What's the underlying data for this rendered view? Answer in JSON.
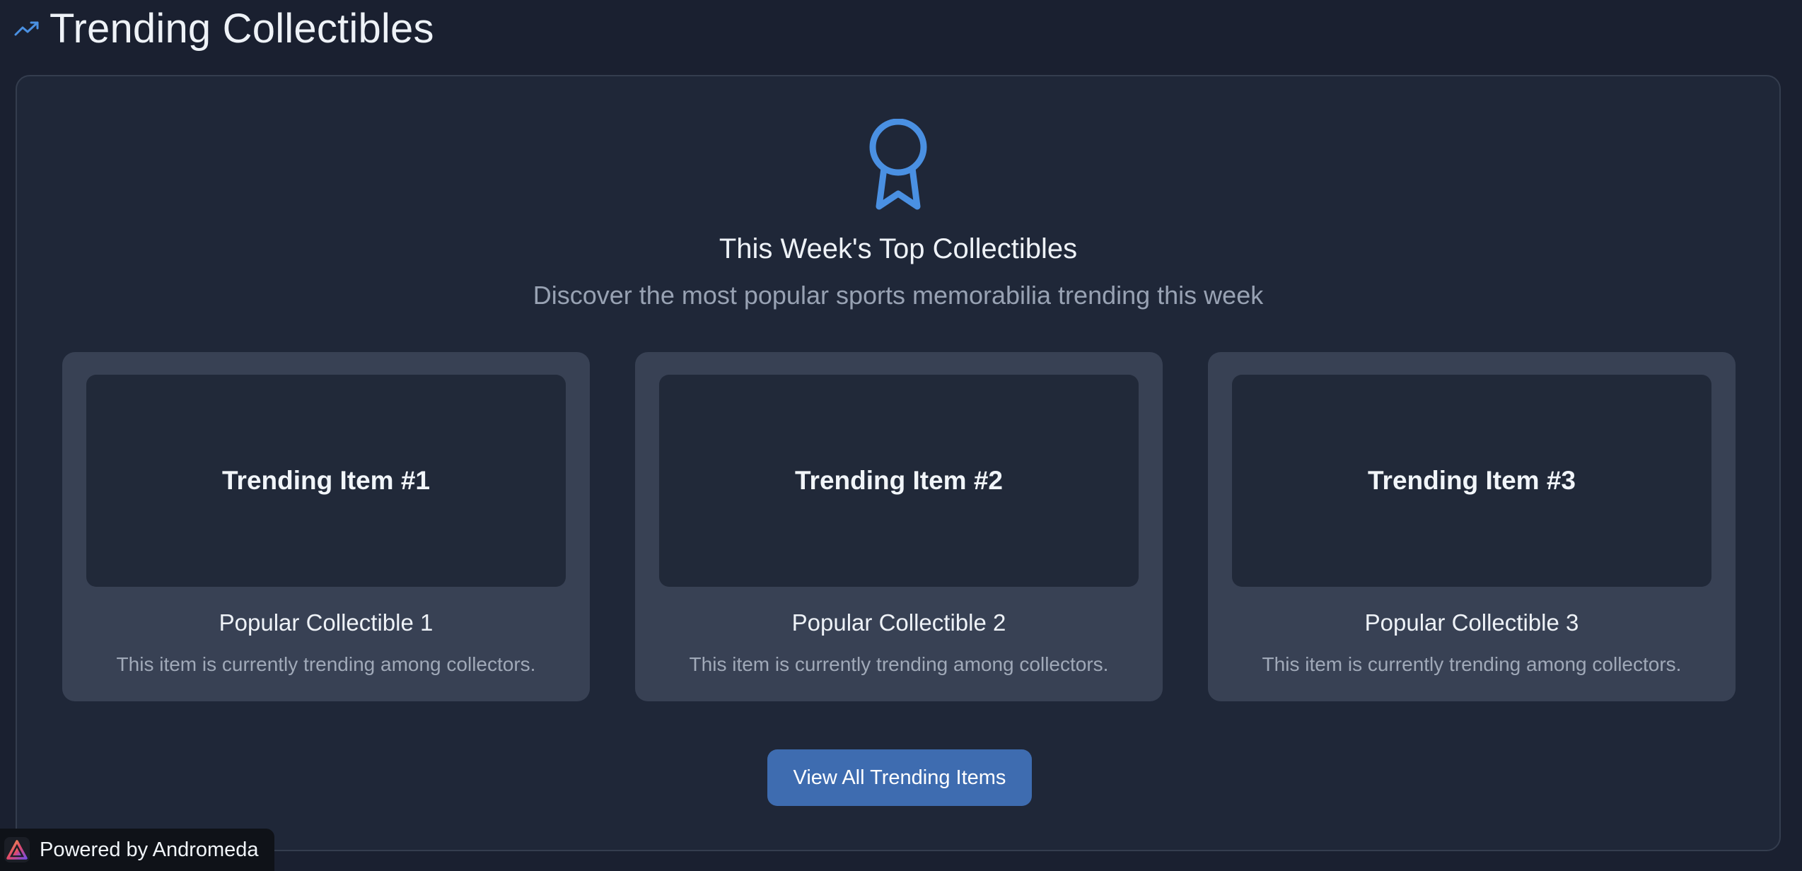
{
  "header": {
    "title": "Trending Collectibles",
    "icon": "trending-up-icon"
  },
  "hero": {
    "icon": "award-icon",
    "title": "This Week's Top Collectibles",
    "subtitle": "Discover the most popular sports memorabilia trending this week"
  },
  "cards": [
    {
      "image_label": "Trending Item #1",
      "title": "Popular Collectible 1",
      "description": "This item is currently trending among collectors."
    },
    {
      "image_label": "Trending Item #2",
      "title": "Popular Collectible 2",
      "description": "This item is currently trending among collectors."
    },
    {
      "image_label": "Trending Item #3",
      "title": "Popular Collectible 3",
      "description": "This item is currently trending among collectors."
    }
  ],
  "actions": {
    "view_all_label": "View All Trending Items"
  },
  "footer_badge": {
    "text": "Powered by Andromeda",
    "icon": "andromeda-logo-icon"
  },
  "colors": {
    "background": "#1a2030",
    "panel": "#1f2738",
    "card": "#384154",
    "accent": "#4a90e2",
    "button": "#3e6cb0"
  }
}
